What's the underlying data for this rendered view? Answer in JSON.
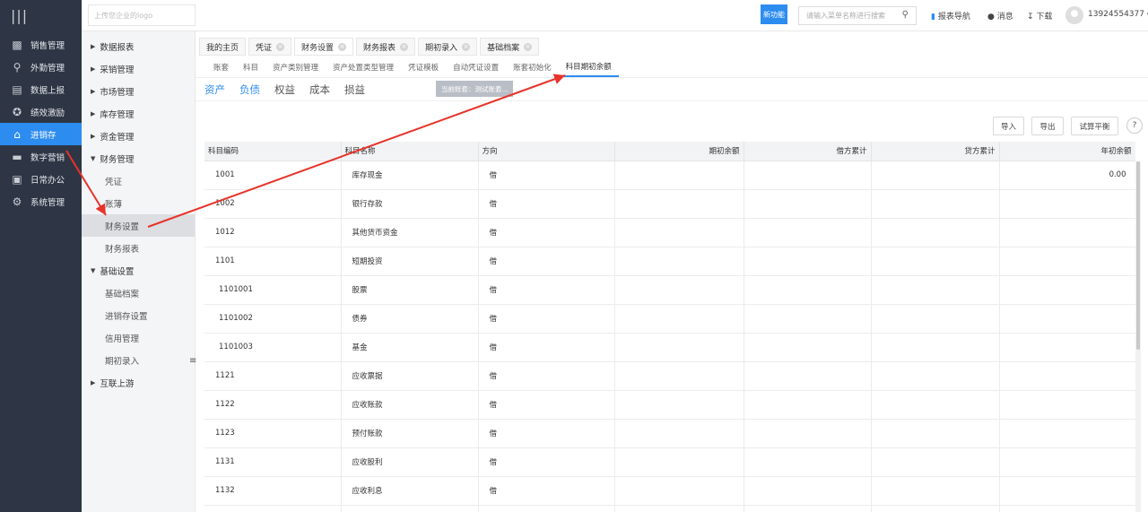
{
  "topbar": {
    "menu_glyph": "|||",
    "logo_placeholder": "上传您企业的logo",
    "new_feature_badge": "新功能",
    "search_placeholder": "请输入菜单名称进行搜索",
    "report_nav": "报表导航",
    "messages": "消息",
    "download": "下载",
    "user_phone": "13924554377"
  },
  "sidenav": {
    "items": [
      {
        "label": "销售管理",
        "icon": "building-icon"
      },
      {
        "label": "外勤管理",
        "icon": "location-icon"
      },
      {
        "label": "数据上报",
        "icon": "report-icon"
      },
      {
        "label": "绩效激励",
        "icon": "medal-icon"
      },
      {
        "label": "进销存",
        "icon": "warehouse-icon"
      },
      {
        "label": "数字营销",
        "icon": "drawer-icon"
      },
      {
        "label": "日常办公",
        "icon": "briefcase-icon"
      },
      {
        "label": "系统管理",
        "icon": "gear-icon"
      }
    ],
    "active_index": 4
  },
  "submenu": {
    "groups": [
      {
        "label": "数据报表",
        "expanded": false
      },
      {
        "label": "采销管理",
        "expanded": false
      },
      {
        "label": "市场管理",
        "expanded": false
      },
      {
        "label": "库存管理",
        "expanded": false
      },
      {
        "label": "资金管理",
        "expanded": false
      },
      {
        "label": "财务管理",
        "expanded": true,
        "children": [
          "凭证",
          "账薄",
          "财务设置",
          "财务报表"
        ]
      },
      {
        "label": "基础设置",
        "expanded": true,
        "children": [
          "基础档案",
          "进销存设置",
          "信用管理",
          "期初录入"
        ]
      },
      {
        "label": "互联上游",
        "expanded": false
      }
    ],
    "active_child": "财务设置"
  },
  "tabs": [
    {
      "label": "我的主页",
      "closable": false
    },
    {
      "label": "凭证",
      "closable": true
    },
    {
      "label": "财务设置",
      "closable": true,
      "active": true
    },
    {
      "label": "财务报表",
      "closable": true
    },
    {
      "label": "期初录入",
      "closable": true
    },
    {
      "label": "基础档案",
      "closable": true
    }
  ],
  "subtabs": {
    "items": [
      "账套",
      "科目",
      "资产类别管理",
      "资产处置类型管理",
      "凭证模板",
      "自动凭证设置",
      "账套初始化",
      "科目期初余额"
    ],
    "active": "科目期初余额"
  },
  "category_tabs": {
    "items": [
      "资产",
      "负债",
      "权益",
      "成本",
      "损益"
    ],
    "active": "资产"
  },
  "book_badge": "当前账套：测试账套...",
  "actions": {
    "import": "导入",
    "export": "导出",
    "trial_balance": "试算平衡",
    "help_glyph": "?"
  },
  "table": {
    "columns": [
      "科目编码",
      "科目名称",
      "方向",
      "期初余额",
      "借方累计",
      "贷方累计",
      "年初余额"
    ],
    "rows": [
      {
        "code": "1001",
        "name": "库存现金",
        "direction": "借",
        "opening": "",
        "debit": "",
        "credit": "",
        "year_start": "0.00"
      },
      {
        "code": "1002",
        "name": "银行存款",
        "direction": "借",
        "opening": "",
        "debit": "",
        "credit": "",
        "year_start": ""
      },
      {
        "code": "1012",
        "name": "其他货币资金",
        "direction": "借",
        "opening": "",
        "debit": "",
        "credit": "",
        "year_start": ""
      },
      {
        "code": "1101",
        "name": "短期投资",
        "direction": "借",
        "opening": "",
        "debit": "",
        "credit": "",
        "year_start": ""
      },
      {
        "code": "1101001",
        "name": "股票",
        "direction": "借",
        "opening": "",
        "debit": "",
        "credit": "",
        "year_start": ""
      },
      {
        "code": "1101002",
        "name": "债券",
        "direction": "借",
        "opening": "",
        "debit": "",
        "credit": "",
        "year_start": ""
      },
      {
        "code": "1101003",
        "name": "基金",
        "direction": "借",
        "opening": "",
        "debit": "",
        "credit": "",
        "year_start": ""
      },
      {
        "code": "1121",
        "name": "应收票据",
        "direction": "借",
        "opening": "",
        "debit": "",
        "credit": "",
        "year_start": ""
      },
      {
        "code": "1122",
        "name": "应收账款",
        "direction": "借",
        "opening": "",
        "debit": "",
        "credit": "",
        "year_start": ""
      },
      {
        "code": "1123",
        "name": "预付账款",
        "direction": "借",
        "opening": "",
        "debit": "",
        "credit": "",
        "year_start": ""
      },
      {
        "code": "1131",
        "name": "应收股利",
        "direction": "借",
        "opening": "",
        "debit": "",
        "credit": "",
        "year_start": ""
      },
      {
        "code": "1132",
        "name": "应收利息",
        "direction": "借",
        "opening": "",
        "debit": "",
        "credit": "",
        "year_start": ""
      },
      {
        "code": "",
        "name": "",
        "direction": "",
        "opening": "",
        "debit": "",
        "credit": "",
        "year_start": ""
      }
    ]
  },
  "colors": {
    "nav_bg": "#2e3645",
    "accent": "#2d8cf0",
    "annotation_arrow": "#e8332a"
  }
}
